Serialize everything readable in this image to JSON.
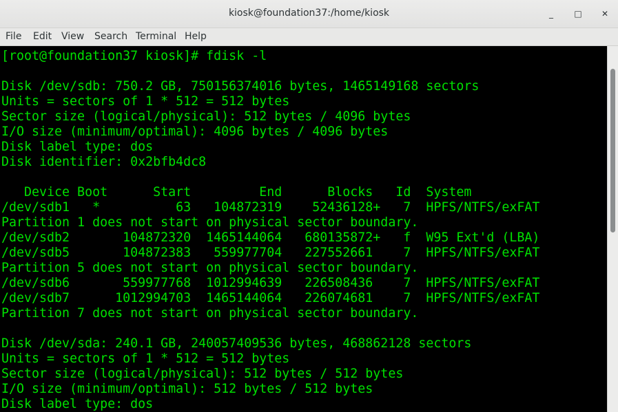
{
  "window": {
    "title": "kiosk@foundation37:/home/kiosk",
    "controls": {
      "minimize": "_",
      "maximize": "□",
      "close": "✕"
    }
  },
  "menubar": {
    "items": [
      "File",
      "Edit",
      "View",
      "Search",
      "Terminal",
      "Help"
    ]
  },
  "terminal": {
    "text_color": "#00e000",
    "background": "#000000",
    "lines": [
      "[root@foundation37 kiosk]# fdisk -l",
      "",
      "Disk /dev/sdb: 750.2 GB, 750156374016 bytes, 1465149168 sectors",
      "Units = sectors of 1 * 512 = 512 bytes",
      "Sector size (logical/physical): 512 bytes / 4096 bytes",
      "I/O size (minimum/optimal): 4096 bytes / 4096 bytes",
      "Disk label type: dos",
      "Disk identifier: 0x2bfb4dc8",
      "",
      "   Device Boot      Start         End      Blocks   Id  System",
      "/dev/sdb1   *          63   104872319    52436128+   7  HPFS/NTFS/exFAT",
      "Partition 1 does not start on physical sector boundary.",
      "/dev/sdb2       104872320  1465144064   680135872+   f  W95 Ext'd (LBA)",
      "/dev/sdb5       104872383   559977704   227552661    7  HPFS/NTFS/exFAT",
      "Partition 5 does not start on physical sector boundary.",
      "/dev/sdb6       559977768  1012994639   226508436    7  HPFS/NTFS/exFAT",
      "/dev/sdb7      1012994703  1465144064   226074681    7  HPFS/NTFS/exFAT",
      "Partition 7 does not start on physical sector boundary.",
      "",
      "Disk /dev/sda: 240.1 GB, 240057409536 bytes, 468862128 sectors",
      "Units = sectors of 1 * 512 = 512 bytes",
      "Sector size (logical/physical): 512 bytes / 512 bytes",
      "I/O size (minimum/optimal): 512 bytes / 512 bytes",
      "Disk label type: dos"
    ]
  }
}
